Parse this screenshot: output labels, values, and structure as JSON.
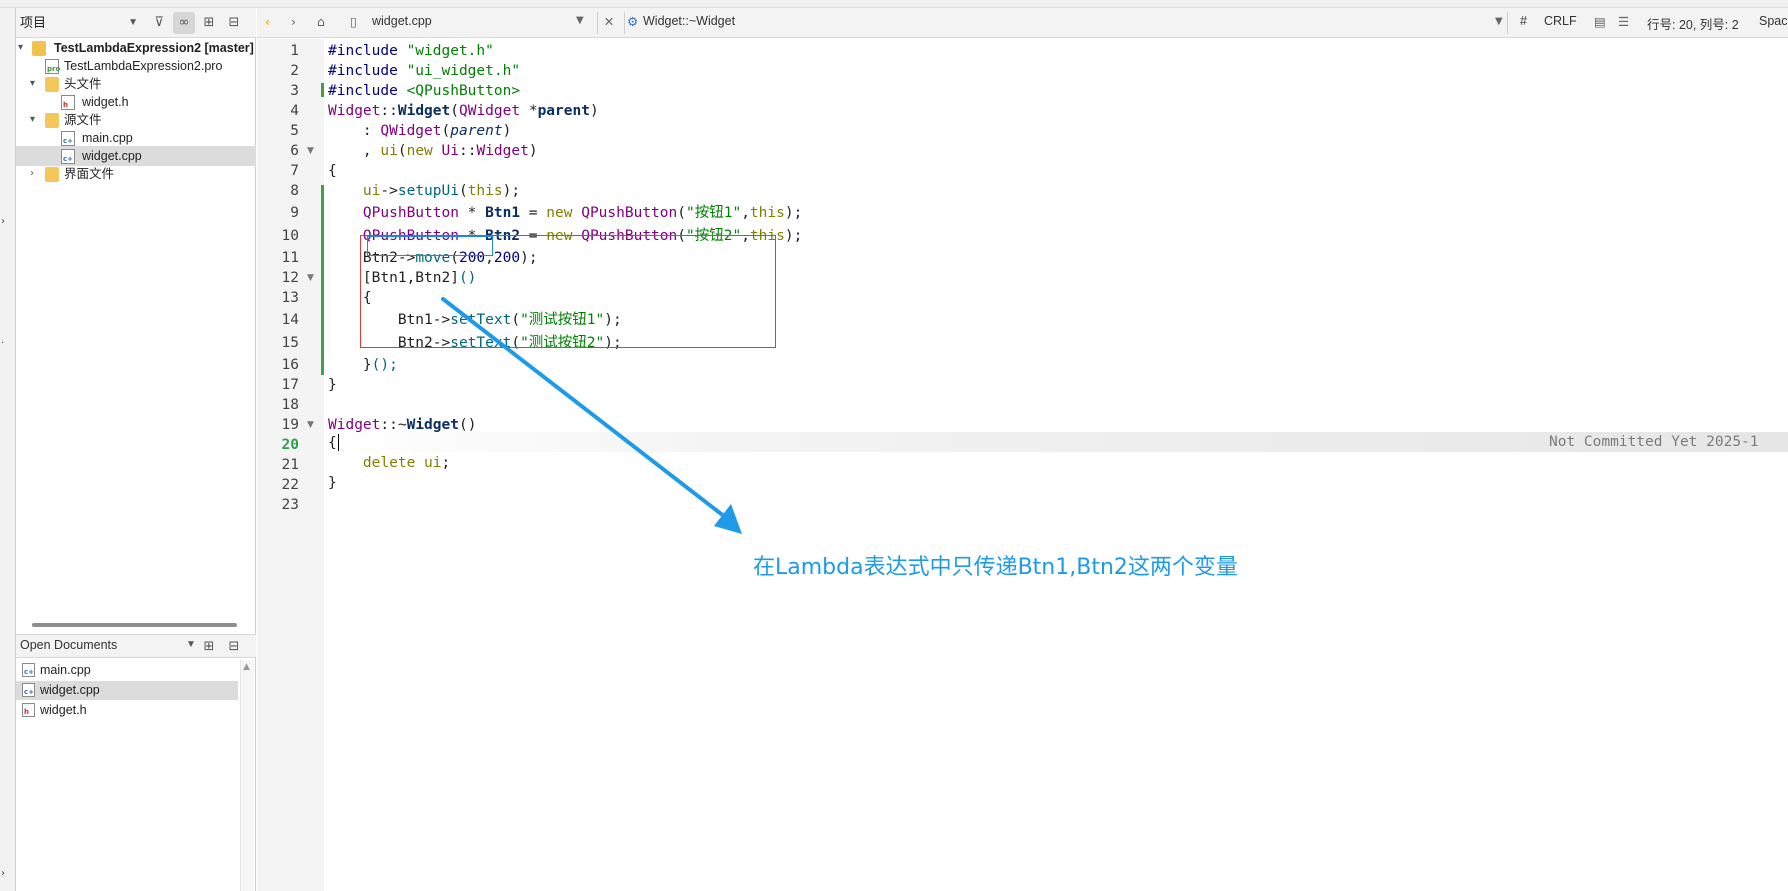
{
  "panel": {
    "selector": "项目",
    "tree": [
      {
        "label": "TestLambdaExpression2 [master]",
        "kind": "project"
      },
      {
        "label": "TestLambdaExpression2.pro",
        "kind": "pro"
      },
      {
        "label": "头文件",
        "kind": "folder"
      },
      {
        "label": "widget.h",
        "kind": "h"
      },
      {
        "label": "源文件",
        "kind": "folder"
      },
      {
        "label": "main.cpp",
        "kind": "cpp"
      },
      {
        "label": "widget.cpp",
        "kind": "cpp"
      },
      {
        "label": "界面文件",
        "kind": "folder"
      }
    ],
    "open_documents_title": "Open Documents",
    "open_documents": [
      "main.cpp",
      "widget.cpp",
      "widget.h"
    ]
  },
  "editor_toolbar": {
    "file": "widget.cpp",
    "symbol": "Widget::~Widget",
    "hash": "#",
    "line_ending": "CRLF",
    "position": "行号: 20, 列号: 2",
    "indent": "Space"
  },
  "editor": {
    "line_numbers": [
      "1",
      "2",
      "3",
      "4",
      "5",
      "6",
      "7",
      "8",
      "9",
      "10",
      "11",
      "12",
      "13",
      "14",
      "15",
      "16",
      "17",
      "18",
      "19",
      "20",
      "21",
      "22",
      "23"
    ],
    "blame": "Not Committed Yet 2025-1",
    "code": {
      "l1a": "#include ",
      "l1b": "\"widget.h\"",
      "l2a": "#include ",
      "l2b": "\"ui_widget.h\"",
      "l3a": "#include ",
      "l3b": "<QPushButton>",
      "l4a": "Widget",
      "l4b": "::",
      "l4c": "Widget",
      "l4d": "(",
      "l4e": "QWidget",
      "l4f": " *",
      "l4g": "parent",
      "l4h": ")",
      "l5a": "    : ",
      "l5b": "QWidget",
      "l5c": "(",
      "l5d": "parent",
      "l5e": ")",
      "l6a": "    , ",
      "l6b": "ui",
      "l6c": "(",
      "l6d": "new",
      "l6e": " Ui",
      "l6f": "::",
      "l6g": "Widget",
      "l6h": ")",
      "l7": "{",
      "l8a": "    ",
      "l8b": "ui",
      "l8c": "->",
      "l8d": "setupUi",
      "l8e": "(",
      "l8f": "this",
      "l8g": ");",
      "l9a": "    ",
      "l9b": "QPushButton",
      "l9c": " * ",
      "l9d": "Btn1",
      "l9e": " = ",
      "l9f": "new",
      "l9g": " ",
      "l9h": "QPushButton",
      "l9i": "(",
      "l9j": "\"按钮1\"",
      "l9k": ",",
      "l9l": "this",
      "l9m": ");",
      "l10a": "    ",
      "l10b": "QPushButton",
      "l10c": " * ",
      "l10d": "Btn2",
      "l10e": " = ",
      "l10f": "new",
      "l10g": " ",
      "l10h": "QPushButton",
      "l10i": "(",
      "l10j": "\"按钮2\"",
      "l10k": ",",
      "l10l": "this",
      "l10m": ");",
      "l11a": "    Btn2->",
      "l11b": "move",
      "l11c": "(",
      "l11d": "200",
      "l11e": ",",
      "l11f": "200",
      "l11g": ");",
      "l12a": "    [Btn1,Btn2]",
      "l12b": "()",
      "l13": "    {",
      "l14a": "        Btn1->",
      "l14b": "setText",
      "l14c": "(",
      "l14d": "\"测试按钮1\"",
      "l14e": ");",
      "l15a": "        Btn2->",
      "l15b": "setText",
      "l15c": "(",
      "l15d": "\"测试按钮2\"",
      "l15e": ");",
      "l16a": "    }",
      "l16b": "();",
      "l17": "}",
      "l19a": "Widget",
      "l19b": "::~",
      "l19c": "Widget",
      "l19d": "()",
      "l20": "{",
      "l21a": "    ",
      "l21b": "delete",
      "l21c": " ",
      "l21d": "ui",
      "l21e": ";",
      "l22": "}"
    }
  },
  "annotation": {
    "text": "在Lambda表达式中只传递Btn1,Btn2这两个变量",
    "box_color": "#e53935",
    "arrow_color": "#1e9be8"
  }
}
